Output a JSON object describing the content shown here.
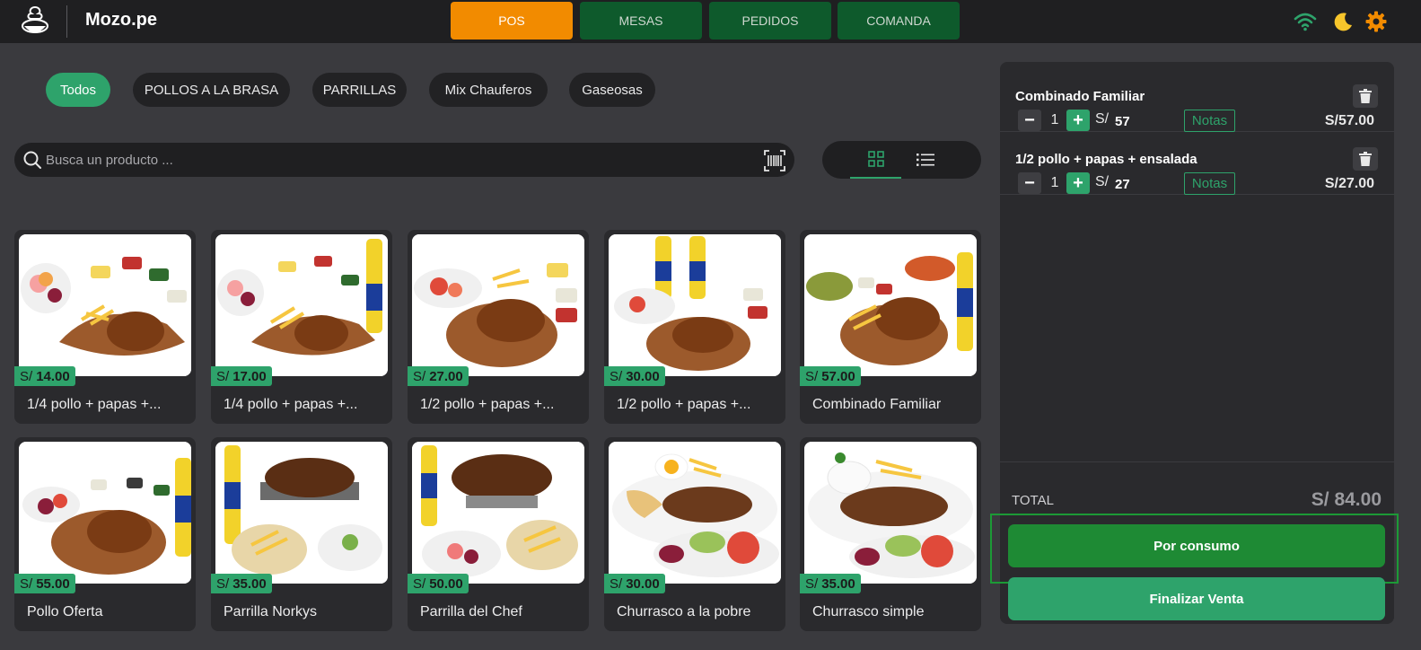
{
  "header": {
    "brand": "Mozo.pe",
    "tabs": [
      {
        "label": "POS",
        "active": true
      },
      {
        "label": "MESAS",
        "active": false
      },
      {
        "label": "PEDIDOS",
        "active": false
      },
      {
        "label": "COMANDA",
        "active": false
      }
    ],
    "icons": [
      "chef-logo-icon",
      "wifi-icon",
      "moon-icon",
      "gear-icon"
    ]
  },
  "categories": [
    {
      "label": "Todos",
      "active": true
    },
    {
      "label": "POLLOS A LA BRASA"
    },
    {
      "label": "PARRILLAS"
    },
    {
      "label": "Mix Chauferos"
    },
    {
      "label": "Gaseosas"
    }
  ],
  "search": {
    "placeholder": "Busca un producto ..."
  },
  "products": [
    {
      "currency": "S/",
      "price": "14.00",
      "name": "1/4 pollo + papas +..."
    },
    {
      "currency": "S/",
      "price": "17.00",
      "name": "1/4 pollo + papas +..."
    },
    {
      "currency": "S/",
      "price": "27.00",
      "name": "1/2 pollo + papas +..."
    },
    {
      "currency": "S/",
      "price": "30.00",
      "name": "1/2 pollo + papas +..."
    },
    {
      "currency": "S/",
      "price": "57.00",
      "name": "Combinado Familiar"
    },
    {
      "currency": "S/",
      "price": "55.00",
      "name": "Pollo Oferta"
    },
    {
      "currency": "S/",
      "price": "35.00",
      "name": "Parrilla Norkys"
    },
    {
      "currency": "S/",
      "price": "50.00",
      "name": "Parrilla del Chef"
    },
    {
      "currency": "S/",
      "price": "30.00",
      "name": "Churrasco a la pobre"
    },
    {
      "currency": "S/",
      "price": "35.00",
      "name": "Churrasco simple"
    }
  ],
  "order": {
    "items": [
      {
        "name": "Combinado Familiar",
        "qty": "1",
        "currency": "S/",
        "unit_price": "57",
        "notes_label": "Notas",
        "total": "S/57.00"
      },
      {
        "name": "1/2 pollo + papas + ensalada",
        "qty": "1",
        "currency": "S/",
        "unit_price": "27",
        "notes_label": "Notas",
        "total": "S/27.00"
      }
    ],
    "total_label": "TOTAL",
    "total_value": "S/ 84.00",
    "consumo_label": "Por consumo",
    "finalizar_label": "Finalizar Venta"
  },
  "colors": {
    "accent": "#f28b00",
    "green": "#2ea36b",
    "dark_green": "#0e5a2c",
    "background": "#3a3a3e"
  }
}
